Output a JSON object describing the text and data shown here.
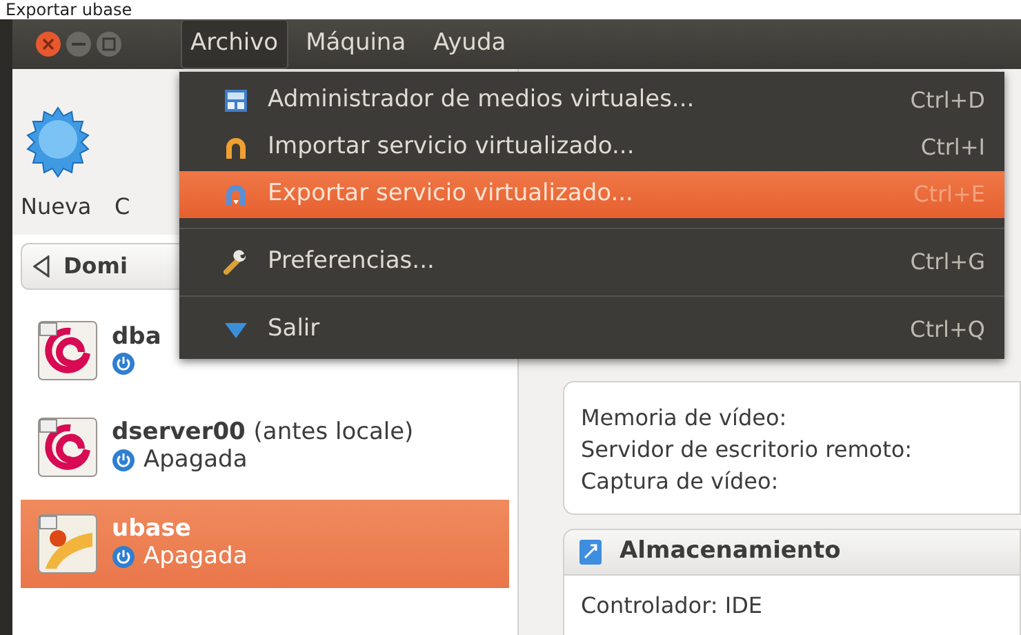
{
  "caption": "Exportar ubase",
  "menubar": [
    {
      "label": "Archivo",
      "selected": true
    },
    {
      "label": "Máquina",
      "selected": false
    },
    {
      "label": "Ayuda",
      "selected": false
    }
  ],
  "menu": [
    {
      "kind": "item",
      "label": "Administrador de medios virtuales...",
      "shortcut": "Ctrl+D",
      "selected": false
    },
    {
      "kind": "item",
      "label": "Importar servicio virtualizado...",
      "shortcut": "Ctrl+I",
      "selected": false
    },
    {
      "kind": "item",
      "label": "Exportar servicio virtualizado...",
      "shortcut": "Ctrl+E",
      "selected": true
    },
    {
      "kind": "separator"
    },
    {
      "kind": "item",
      "label": "Preferencias...",
      "shortcut": "Ctrl+G",
      "selected": false
    },
    {
      "kind": "separator"
    },
    {
      "kind": "item",
      "label": "Salir",
      "shortcut": "Ctrl+Q",
      "selected": false
    }
  ],
  "toolbar": [
    {
      "label": "Nueva"
    },
    {
      "label": "C"
    }
  ],
  "tab": {
    "label": "Domi"
  },
  "machines": [
    {
      "kind": "debian",
      "name": "dba",
      "selected": false
    },
    {
      "kind": "debian",
      "name": "dserver00",
      "note": "(antes locale)",
      "status": "Apagada",
      "selected": false
    },
    {
      "kind": "ubuntu",
      "name": "ubase",
      "status": "Apagada",
      "selected": true
    }
  ],
  "details": {
    "lines": [
      "Memoria de vídeo:",
      "Servidor de escritorio remoto:",
      "Captura de vídeo:"
    ],
    "storage": {
      "title": "Almacenamiento",
      "lines": [
        "Controlador: IDE"
      ]
    }
  }
}
